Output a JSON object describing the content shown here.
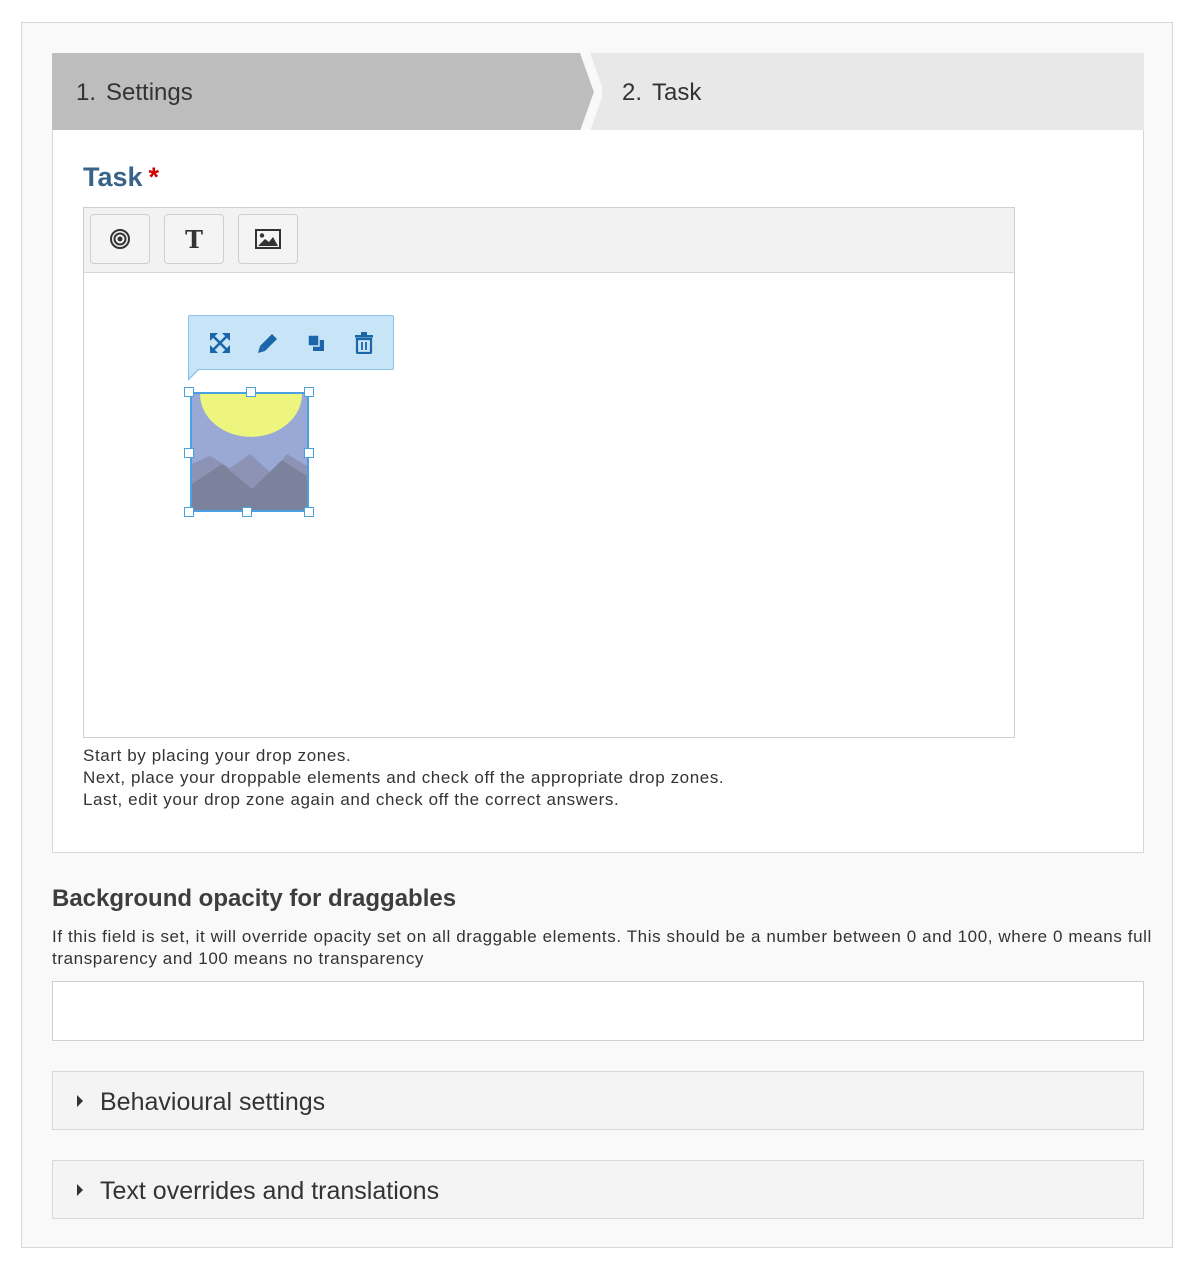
{
  "wizard": {
    "steps": [
      {
        "num": "1.",
        "label": "Settings",
        "active": true
      },
      {
        "num": "2.",
        "label": "Task",
        "active": false
      }
    ]
  },
  "task": {
    "title": "Task",
    "required_mark": "*",
    "toolbar": {
      "dropzone_icon": "target-icon",
      "text_button_glyph": "T",
      "image_icon": "image-icon"
    },
    "context_menu": [
      "resize-icon",
      "pencil-icon",
      "layers-icon",
      "trash-icon"
    ],
    "hints": [
      "Start by placing your drop zones.",
      "Next, place your droppable elements and check off the appropriate drop zones.",
      "Last, edit your drop zone again and check off the correct answers."
    ]
  },
  "opacity": {
    "label": "Background opacity for draggables",
    "description": "If this field is set, it will override opacity set on all draggable elements. This should be a number between 0 and 100, where 0 means full transparency and 100 means no transparency",
    "value": ""
  },
  "groups": [
    {
      "label": "Behavioural settings"
    },
    {
      "label": "Text overrides and translations"
    }
  ],
  "colors": {
    "title": "#3a6389",
    "required": "#cc0000",
    "active_step": "#bdbdbd",
    "inactive_step": "#e8e8e8",
    "context_menu_bg": "#c8e4f7",
    "context_icon": "#1a66a8",
    "selection": "#4aa0e0"
  }
}
